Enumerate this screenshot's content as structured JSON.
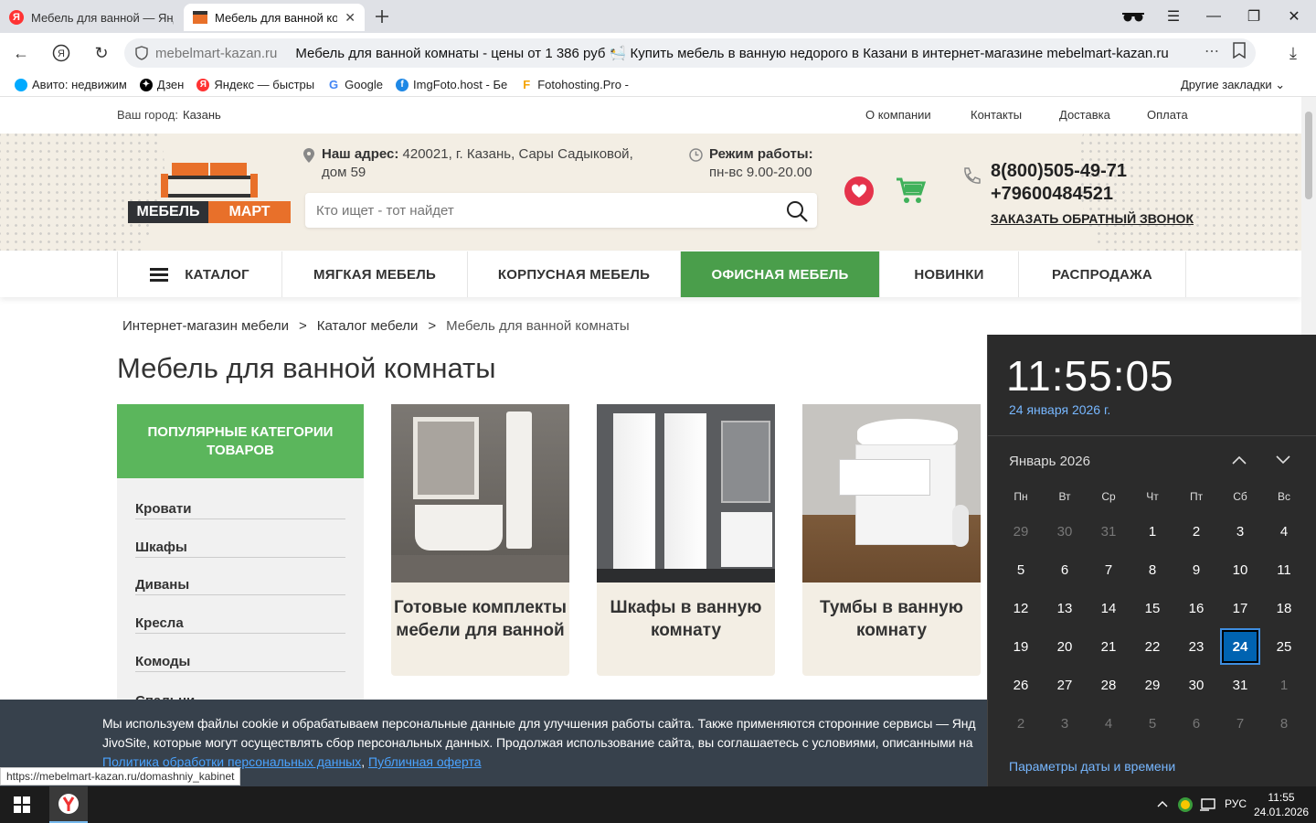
{
  "browser": {
    "tabs": [
      {
        "label": "Мебель для ванной — Янд"
      },
      {
        "label": "Мебель для ванной ко"
      }
    ],
    "url_domain": "mebelmart-kazan.ru",
    "url_title": "Мебель для ванной комнаты - цены от 1 386 руб 🛀 Купить мебель в ванную недорого в Казани в интернет-магазине mebelmart-kazan.ru",
    "bookmarks": [
      {
        "label": "Авито: недвижим",
        "color": "#00aaff"
      },
      {
        "label": "Дзен",
        "color": "#000000"
      },
      {
        "label": "Яндекс — быстры",
        "color": "#ff3333"
      },
      {
        "label": "Google",
        "color": "#4285f4"
      },
      {
        "label": "ImgFoto.host - Бе",
        "color": "#1e88e5"
      },
      {
        "label": "Fotohosting.Pro - ",
        "color": "#f4a300"
      }
    ],
    "other_bookmarks": "Другие закладки",
    "status_url": "https://mebelmart-kazan.ru/domashniy_kabinet"
  },
  "site": {
    "city_label": "Ваш город:",
    "city": "Казань",
    "top_links": [
      "О компании",
      "Контакты",
      "Доставка",
      "Оплата"
    ],
    "logo_left": "МЕБЕЛЬ",
    "logo_right": "МАРТ",
    "address_label": "Наш адрес:",
    "address_line1": "420021, г. Казань, Сары Садыковой,",
    "address_line2": "дом 59",
    "hours_label": "Режим работы:",
    "hours": "пн-вс 9.00-20.00",
    "search_placeholder": "Кто ищет - тот найдет",
    "phone1": "8(800)505-49-71",
    "phone2": "+79600484521",
    "callback": "ЗАКАЗАТЬ ОБРАТНЫЙ ЗВОНОК",
    "nav": [
      "КАТАЛОГ",
      "МЯГКАЯ МЕБЕЛЬ",
      "КОРПУСНАЯ МЕБЕЛЬ",
      "ОФИСНАЯ МЕБЕЛЬ",
      "НОВИНКИ",
      "РАСПРОДАЖА"
    ],
    "accent_green": "#4a9e4b",
    "accent_orange": "#e8702a",
    "breadcrumb": [
      "Интернет-магазин мебели",
      ">",
      "Каталог мебели",
      ">",
      "Мебель для ванной комнаты"
    ],
    "page_title": "Мебель для ванной комнаты",
    "sidebar_title": "ПОПУЛЯРНЫЕ КАТЕГОРИИ ТОВАРОВ",
    "sidebar_items": [
      "Кровати",
      "Шкафы",
      "Диваны",
      "Кресла",
      "Комоды",
      "Спальни"
    ],
    "cards": [
      {
        "title": "Готовые комплекты мебели для ванной"
      },
      {
        "title": "Шкафы в ванную комнату"
      },
      {
        "title": "Тумбы в ванную комнату"
      }
    ],
    "cookie_line1": "Мы используем файлы cookie и обрабатываем персональные данные для улучшения работы сайта. Также применяются сторонние сервисы — Янд",
    "cookie_line2": "JivoSite, которые могут осуществлять сбор персональных данных. Продолжая использование сайта, вы соглашаетесь с условиями, описанными на",
    "cookie_link1": "Политика обработки персональных данных",
    "cookie_sep": ",",
    "cookie_link2": "Публичная оферта"
  },
  "flyout": {
    "time": "11:55:05",
    "date": "24 января 2026 г.",
    "month": "Январь 2026",
    "weekdays": [
      "Пн",
      "Вт",
      "Ср",
      "Чт",
      "Пт",
      "Сб",
      "Вс"
    ],
    "weeks": [
      [
        "29",
        "30",
        "31",
        "1",
        "2",
        "3",
        "4"
      ],
      [
        "5",
        "6",
        "7",
        "8",
        "9",
        "10",
        "11"
      ],
      [
        "12",
        "13",
        "14",
        "15",
        "16",
        "17",
        "18"
      ],
      [
        "19",
        "20",
        "21",
        "22",
        "23",
        "24",
        "25"
      ],
      [
        "26",
        "27",
        "28",
        "29",
        "30",
        "31",
        "1"
      ],
      [
        "2",
        "3",
        "4",
        "5",
        "6",
        "7",
        "8"
      ]
    ],
    "selected_day": "24",
    "settings_link": "Параметры даты и времени"
  },
  "taskbar": {
    "lang": "РУС",
    "time": "11:55",
    "date": "24.01.2026"
  }
}
